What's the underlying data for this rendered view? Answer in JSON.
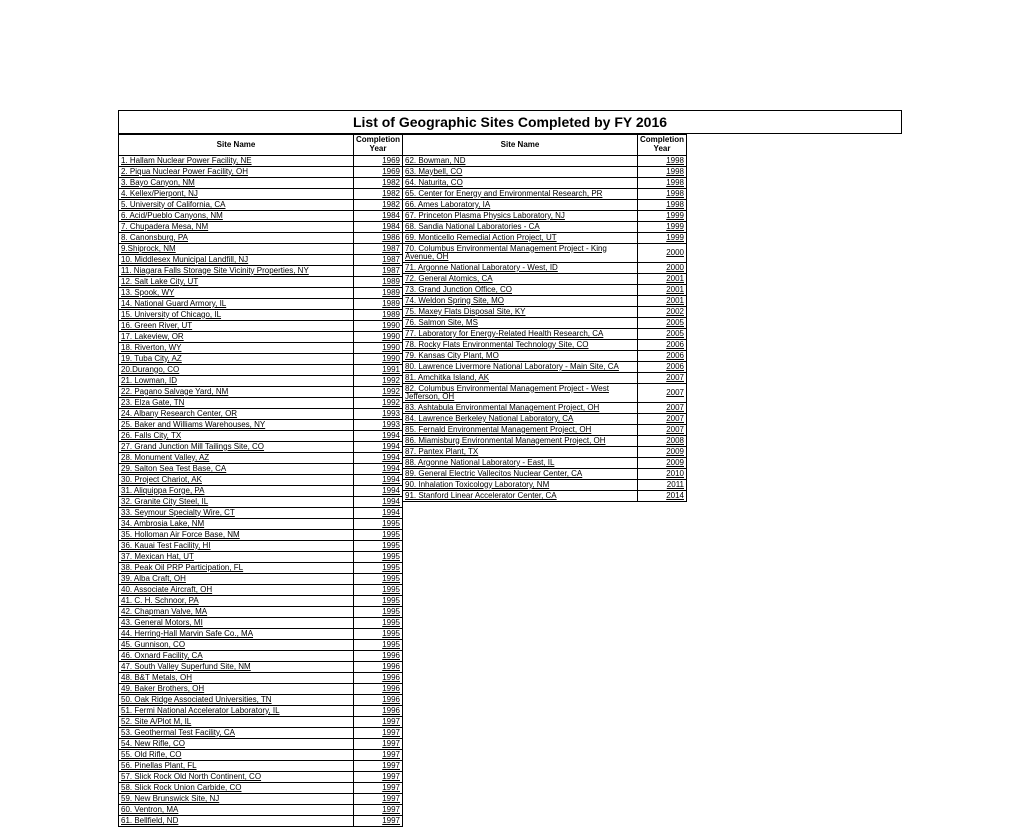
{
  "title": "List of Geographic Sites Completed by FY 2016",
  "headers": {
    "site_name": "Site Name",
    "completion_year": "Completion Year"
  },
  "left": [
    {
      "n": "1. Hallam Nuclear Power Facility, NE",
      "y": "1969"
    },
    {
      "n": "2. Piqua Nuclear Power Facility, OH",
      "y": "1969"
    },
    {
      "n": "3. Bayo Canyon, NM",
      "y": "1982"
    },
    {
      "n": "4. Kellex/Pierpont, NJ",
      "y": "1982"
    },
    {
      "n": "5. University of California, CA",
      "y": "1982"
    },
    {
      "n": "6. Acid/Pueblo Canyons, NM",
      "y": "1984"
    },
    {
      "n": "7. Chupadera Mesa, NM",
      "y": "1984"
    },
    {
      "n": "8. Canonsburg, PA",
      "y": "1986"
    },
    {
      "n": "9.Shiprock, NM",
      "y": "1987"
    },
    {
      "n": "10. Middlesex Municipal Landfill, NJ",
      "y": "1987"
    },
    {
      "n": "11. Niagara Falls Storage Site Vicinity Properties, NY",
      "y": "1987"
    },
    {
      "n": "12. Salt Lake City, UT",
      "y": "1989"
    },
    {
      "n": "13. Spook, WY",
      "y": "1989"
    },
    {
      "n": "14. National Guard Armory, IL",
      "y": "1989"
    },
    {
      "n": "15. University of Chicago, IL",
      "y": "1989"
    },
    {
      "n": "16. Green River, UT",
      "y": "1990"
    },
    {
      "n": "17. Lakeview, OR",
      "y": "1990"
    },
    {
      "n": "18. Riverton, WY",
      "y": "1990"
    },
    {
      "n": "19. Tuba City, AZ",
      "y": "1990"
    },
    {
      "n": "20.Durango, CO",
      "y": "1991"
    },
    {
      "n": "21. Lowman, ID",
      "y": "1992"
    },
    {
      "n": "22. Pagano Salvage Yard, NM",
      "y": "1992"
    },
    {
      "n": "23. Elza Gate, TN",
      "y": "1992"
    },
    {
      "n": "24. Albany Research Center, OR",
      "y": "1993"
    },
    {
      "n": "25. Baker and Williams Warehouses, NY",
      "y": "1993"
    },
    {
      "n": "26. Falls City, TX",
      "y": "1994"
    },
    {
      "n": "27. Grand Junction Mill Tailings Site, CO",
      "y": "1994"
    },
    {
      "n": "28. Monument Valley, AZ",
      "y": "1994"
    },
    {
      "n": "29. Salton Sea Test Base, CA",
      "y": "1994"
    },
    {
      "n": "30. Project Chariot, AK",
      "y": "1994"
    },
    {
      "n": "31. Aliquippa Forge, PA",
      "y": "1994"
    },
    {
      "n": "32. Granite City Steel, IL",
      "y": "1994"
    },
    {
      "n": "33. Seymour Specialty Wire, CT",
      "y": "1994"
    },
    {
      "n": "34. Ambrosia Lake, NM",
      "y": "1995"
    },
    {
      "n": "35. Holloman Air Force Base, NM",
      "y": "1995"
    },
    {
      "n": "36. Kauai Test Facility, HI",
      "y": "1995"
    },
    {
      "n": "37. Mexican Hat, UT",
      "y": "1995"
    },
    {
      "n": "38. Peak Oil PRP Participation, FL",
      "y": "1995"
    },
    {
      "n": "39. Alba Craft, OH",
      "y": "1995"
    },
    {
      "n": "40. Associate Aircraft, OH",
      "y": "1995"
    },
    {
      "n": "41. C. H. Schnoor, PA",
      "y": "1995"
    },
    {
      "n": "42. Chapman Valve, MA",
      "y": "1995"
    },
    {
      "n": "43. General Motors, MI",
      "y": "1995"
    },
    {
      "n": "44. Herring-Hall Marvin Safe Co., MA",
      "y": "1995"
    },
    {
      "n": "45. Gunnison, CO",
      "y": "1995"
    },
    {
      "n": "46. Oxnard Facility, CA",
      "y": "1996"
    },
    {
      "n": "47. South Valley Superfund Site, NM",
      "y": "1996"
    },
    {
      "n": "48. B&T Metals, OH",
      "y": "1996"
    },
    {
      "n": "49. Baker Brothers, OH",
      "y": "1996"
    },
    {
      "n": "50. Oak Ridge Associated Universities, TN",
      "y": "1996"
    },
    {
      "n": "51. Fermi National Accelerator Laboratory, IL",
      "y": "1996"
    },
    {
      "n": "52. Site A/Plot M, IL",
      "y": "1997"
    },
    {
      "n": "53. Geothermal Test Facility, CA",
      "y": "1997"
    },
    {
      "n": "54. New Rifle, CO",
      "y": "1997"
    },
    {
      "n": "55. Old Rifle, CO",
      "y": "1997"
    },
    {
      "n": "56. Pinellas Plant, FL",
      "y": "1997"
    },
    {
      "n": "57. Slick Rock Old North Continent, CO",
      "y": "1997"
    },
    {
      "n": "58. Slick Rock Union Carbide, CO",
      "y": "1997"
    },
    {
      "n": "59. New Brunswick Site, NJ",
      "y": "1997"
    },
    {
      "n": "60. Ventron, MA",
      "y": "1997"
    },
    {
      "n": "61. Bellfield, ND",
      "y": "1997"
    }
  ],
  "right": [
    {
      "n": "62. Bowman, ND",
      "y": "1998"
    },
    {
      "n": "63. Maybell, CO",
      "y": "1998"
    },
    {
      "n": "64. Naturita, CO",
      "y": "1998"
    },
    {
      "n": "65. Center for Energy and Environmental Research, PR",
      "y": "1998"
    },
    {
      "n": "66. Ames Laboratory, IA",
      "y": "1998"
    },
    {
      "n": "67. Princeton Plasma Physics Laboratory, NJ",
      "y": "1999"
    },
    {
      "n": "68. Sandia National Laboratories - CA",
      "y": "1999"
    },
    {
      "n": "69. Monticello Remedial Action Project, UT",
      "y": "1999"
    },
    {
      "n": "70. Columbus Environmental Management Project - King Avenue, OH",
      "y": "2000"
    },
    {
      "n": "71. Argonne National Laboratory - West, ID",
      "y": "2000"
    },
    {
      "n": "72. General Atomics, CA",
      "y": "2001"
    },
    {
      "n": "73. Grand Junction Office, CO",
      "y": "2001"
    },
    {
      "n": "74. Weldon Spring Site, MO",
      "y": "2001"
    },
    {
      "n": "75. Maxey Flats Disposal Site, KY",
      "y": "2002"
    },
    {
      "n": "76. Salmon Site, MS",
      "y": "2005"
    },
    {
      "n": "77. Laboratory for Energy-Related Health Research, CA",
      "y": "2005"
    },
    {
      "n": "78. Rocky Flats Environmental Technology Site, CO",
      "y": "2006"
    },
    {
      "n": "79. Kansas City Plant, MO",
      "y": "2006"
    },
    {
      "n": "80. Lawrence Livermore National Laboratory - Main Site, CA",
      "y": "2006"
    },
    {
      "n": "81. Amchitka Island, AK",
      "y": "2007"
    },
    {
      "n": "82. Columbus Environmental Management Project - West Jefferson, OH",
      "y": "2007"
    },
    {
      "n": "83. Ashtabula Environmental Management Project, OH",
      "y": "2007"
    },
    {
      "n": "84. Lawrence Berkeley National Laboratory, CA",
      "y": "2007"
    },
    {
      "n": "85. Fernald Environmental Management Project, OH",
      "y": "2007"
    },
    {
      "n": "86. Miamisburg Environmental Management Project, OH",
      "y": "2008"
    },
    {
      "n": "87. Pantex Plant, TX",
      "y": "2009"
    },
    {
      "n": "88. Argonne National Laboratory - East, IL",
      "y": "2009"
    },
    {
      "n": "89. General Electric Vallecitos Nuclear Center, CA",
      "y": "2010"
    },
    {
      "n": "90. Inhalation Toxicology Laboratory, NM",
      "y": "2011"
    },
    {
      "n": "91. Stanford Linear Accelerator Center, CA",
      "y": "2014"
    }
  ]
}
